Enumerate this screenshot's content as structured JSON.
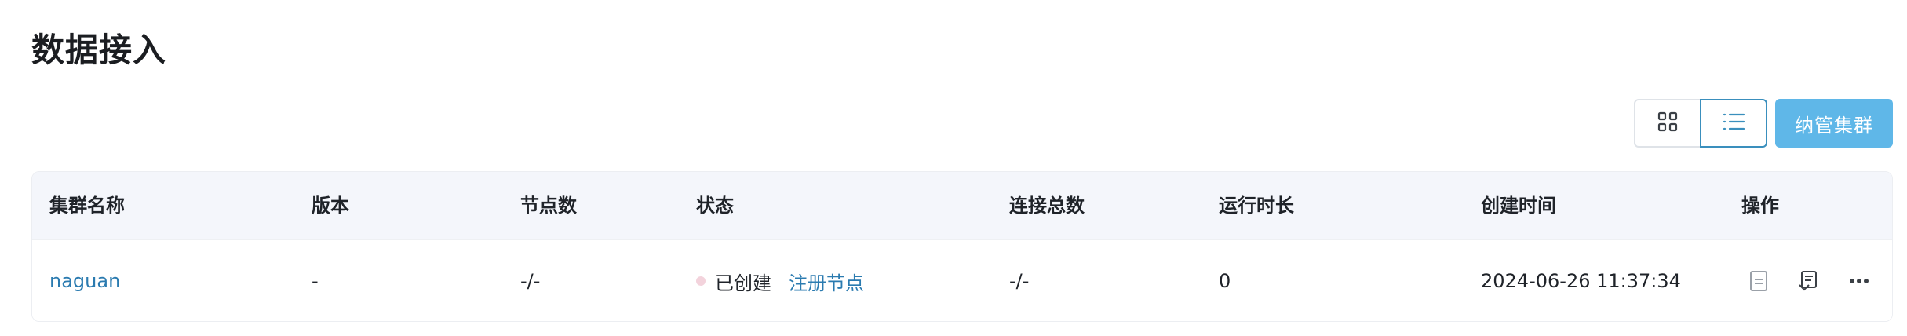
{
  "page": {
    "title": "数据接入"
  },
  "toolbar": {
    "grid_view_icon": "grid-icon",
    "list_view_icon": "list-icon",
    "primary_button_label": "纳管集群",
    "primary_button_color": "#5fb7e8"
  },
  "table": {
    "columns": [
      "集群名称",
      "版本",
      "节点数",
      "状态",
      "连接总数",
      "运行时长",
      "创建时间",
      "操作"
    ],
    "rows": [
      {
        "cluster_name": "naguan",
        "version": "-",
        "nodes": "-/-",
        "status_text": "已创建",
        "status_color": "#f3d3dc",
        "register_link": "注册节点",
        "total_connections": "-/-",
        "uptime": "0",
        "created_at": "2024-06-26 11:37:34",
        "actions": [
          "document-icon",
          "register-node-icon",
          "more-icon"
        ]
      }
    ]
  }
}
